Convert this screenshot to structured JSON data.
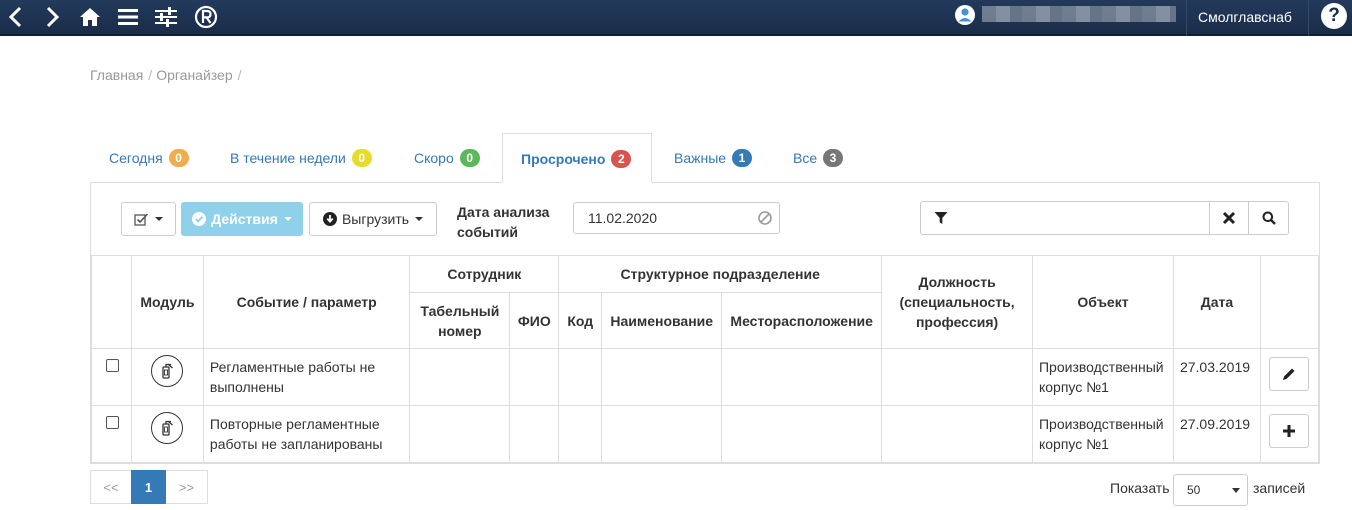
{
  "topbar": {
    "icons": [
      "back-icon",
      "forward-icon",
      "home-icon",
      "menu-icon",
      "settings-sliders-icon",
      "registered-icon"
    ],
    "org_name": "Смолглавснаб",
    "help": "?",
    "colors": {
      "background": "#1f3453",
      "text": "#ffffff"
    }
  },
  "breadcrumb": {
    "items": [
      "Главная",
      "Органайзер"
    ],
    "separator": "/"
  },
  "tabs": [
    {
      "label": "Сегодня",
      "count": "0",
      "color": "#f0ad4e"
    },
    {
      "label": "В течение недели",
      "count": "0",
      "color": "#e6dc2c"
    },
    {
      "label": "Скоро",
      "count": "0",
      "color": "#5cb85c"
    },
    {
      "label": "Просрочено",
      "count": "2",
      "color": "#d9534f",
      "active": true
    },
    {
      "label": "Важные",
      "count": "1",
      "color": "#337ab7"
    },
    {
      "label": "Все",
      "count": "3",
      "color": "#777777"
    }
  ],
  "toolbar": {
    "actions_label": "Действия",
    "export_label": "Выгрузить",
    "date_label_line1": "Дата анализа",
    "date_label_line2": "событий",
    "date_value": "11.02.2020",
    "search_value": "",
    "accent_color": "#8fd1ea"
  },
  "table": {
    "headers": {
      "module": "Модуль",
      "event": "Событие / параметр",
      "employee": "Сотрудник",
      "tab_number": "Табельный номер",
      "fio": "ФИО",
      "division": "Структурное подразделение",
      "code": "Код",
      "name": "Наименование",
      "location": "Месторасположение",
      "position": "Должность (специальность, профессия)",
      "object": "Объект",
      "date": "Дата"
    },
    "rows": [
      {
        "event": "Регламентные работы не выполнены",
        "object": "Производственный корпус №1",
        "date": "27.03.2019",
        "action_icon": "pencil-icon"
      },
      {
        "event": "Повторные регламентные работы не запланированы",
        "object": "Производственный корпус №1",
        "date": "27.09.2019",
        "action_icon": "plus-icon"
      }
    ]
  },
  "pagination": {
    "first": "<<",
    "current": "1",
    "next": ">>",
    "show_label": "Показать",
    "page_size": "50",
    "records_label": "записей"
  }
}
